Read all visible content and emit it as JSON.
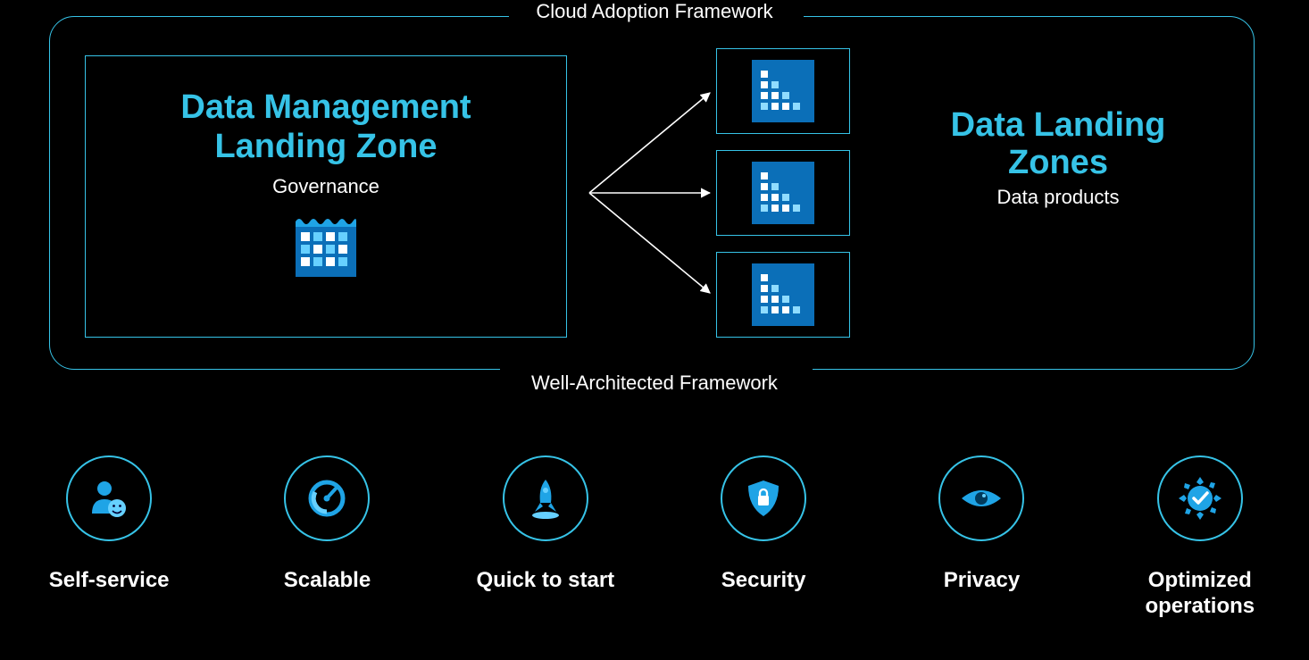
{
  "frame": {
    "top_label": "Cloud Adoption Framework",
    "bottom_label": "Well-Architected Framework"
  },
  "management": {
    "title_line1": "Data Management",
    "title_line2": "Landing Zone",
    "subtitle": "Governance"
  },
  "landing": {
    "title_line1": "Data Landing",
    "title_line2": "Zones",
    "subtitle": "Data products"
  },
  "benefits": [
    {
      "label": "Self-service",
      "icon": "person-smile"
    },
    {
      "label": "Scalable",
      "icon": "gauge"
    },
    {
      "label": "Quick to start",
      "icon": "rocket"
    },
    {
      "label": "Security",
      "icon": "shield-lock"
    },
    {
      "label": "Privacy",
      "icon": "eye"
    },
    {
      "label": "Optimized\noperations",
      "icon": "gear-check"
    }
  ],
  "colors": {
    "accent": "#36c3e7",
    "icon_fill": "#1fa4e6",
    "tile_bg": "#0b6fb8"
  }
}
